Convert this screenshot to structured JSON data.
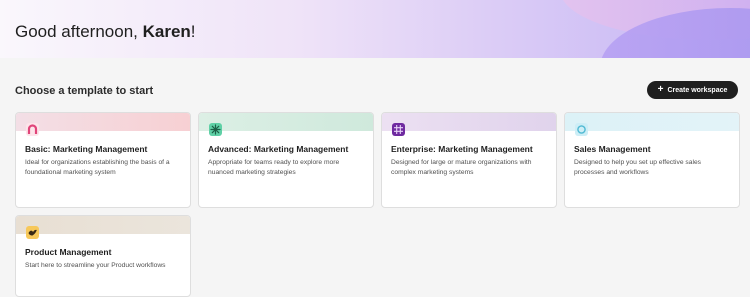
{
  "greeting": {
    "prefix": "Good afternoon, ",
    "name": "Karen",
    "suffix": "!"
  },
  "section_title": "Choose a template to start",
  "create_button": {
    "icon": "plus-icon",
    "label": "Create workspace"
  },
  "templates": [
    {
      "title": "Basic: Marketing Management",
      "description": "Ideal for organizations establishing the basis of a foundational marketing system",
      "icon": "arch-icon",
      "band_color": "#f5d7dc",
      "icon_color": "#e06a8a"
    },
    {
      "title": "Advanced: Marketing Management",
      "description": "Appropriate for teams ready to explore more nuanced marketing strategies",
      "icon": "sparkle-icon",
      "band_color": "#d6ecdf",
      "icon_color": "#4cc59a"
    },
    {
      "title": "Enterprise: Marketing Management",
      "description": "Designed for large or mature organizations with complex marketing systems",
      "icon": "grid-icon",
      "band_color": "#e6d9ee",
      "icon_color": "#7a2fa8"
    },
    {
      "title": "Sales Management",
      "description": "Designed to help you set up effective sales processes and workflows",
      "icon": "circle-icon",
      "band_color": "#d9f1f6",
      "icon_color": "#7ad2e4"
    },
    {
      "title": "Product Management",
      "description": "Start here to streamline your Product workflows",
      "icon": "bird-icon",
      "band_color": "#e9e1d6",
      "icon_color": "#f2b54a"
    }
  ]
}
